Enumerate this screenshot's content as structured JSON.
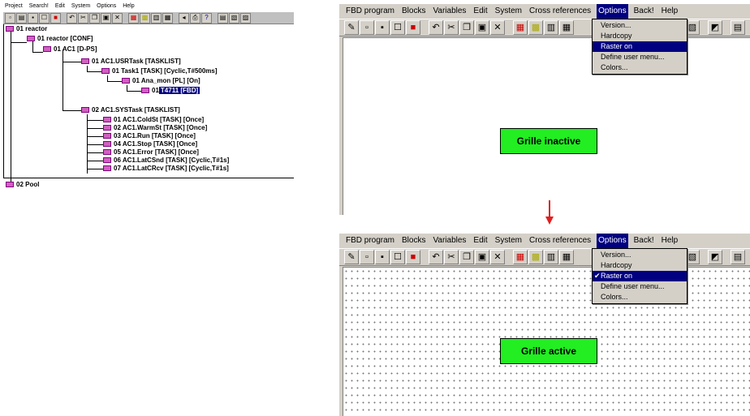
{
  "left_panel": {
    "menu": [
      "Project",
      "Search!",
      "Edit",
      "System",
      "Options",
      "Help"
    ],
    "toolbar_icons": [
      "new-icon",
      "open-icon",
      "save-icon",
      "check-icon",
      "stop-icon",
      "undo-icon",
      "cut-icon",
      "copy-icon",
      "paste-icon",
      "delete-icon",
      "monitor-icon",
      "debug-icon",
      "chart-icon",
      "table-icon",
      "prev-icon",
      "print-icon",
      "help-icon",
      "tile-icon",
      "cascade-icon",
      "window-icon"
    ],
    "tree": [
      {
        "label": "01  reactor"
      },
      {
        "label": "01  reactor  [CONF]"
      },
      {
        "label": "01  AC1  [D-PS]"
      },
      {
        "label": "01  AC1.USRTask  [TASKLIST]"
      },
      {
        "label": "01  Task1  [TASK] [Cyclic,T#500ms]"
      },
      {
        "label": "01  Ana_mon  [PL] [On]"
      },
      {
        "label_prefix": "01 ",
        "label_selected": "T4711  [FBD]"
      },
      {
        "label": "02  AC1.SYSTask  [TASKLIST]"
      },
      {
        "label": "01  AC1.ColdSt  [TASK] [Once]"
      },
      {
        "label": "02  AC1.WarmSt  [TASK] [Once]"
      },
      {
        "label": "03  AC1.Run  [TASK] [Once]"
      },
      {
        "label": "04  AC1.Stop  [TASK] [Once]"
      },
      {
        "label": "05  AC1.Error  [TASK] [Once]"
      },
      {
        "label": "06  AC1.LatCSnd  [TASK] [Cyclic,T#1s]"
      },
      {
        "label": "07  AC1.LatCRcv  [TASK] [Cyclic,T#1s]"
      },
      {
        "label": "02  Pool"
      }
    ]
  },
  "fbd_menu": [
    "FBD program",
    "Blocks",
    "Variables",
    "Edit",
    "System",
    "Cross references",
    "Options",
    "Back!",
    "Help"
  ],
  "options_menu": [
    "Version...",
    "Hardcopy",
    "Raster on",
    "Define user menu...",
    "Colors..."
  ],
  "top_window": {
    "label": "Grille inactive",
    "raster_checked": false
  },
  "bottom_window": {
    "label": "Grille active",
    "raster_checked": true
  },
  "colors": {
    "label_bg": "#22ee22",
    "menu_highlight": "#000080",
    "arrow": "#e02020",
    "tree_node": "#d060c0"
  }
}
